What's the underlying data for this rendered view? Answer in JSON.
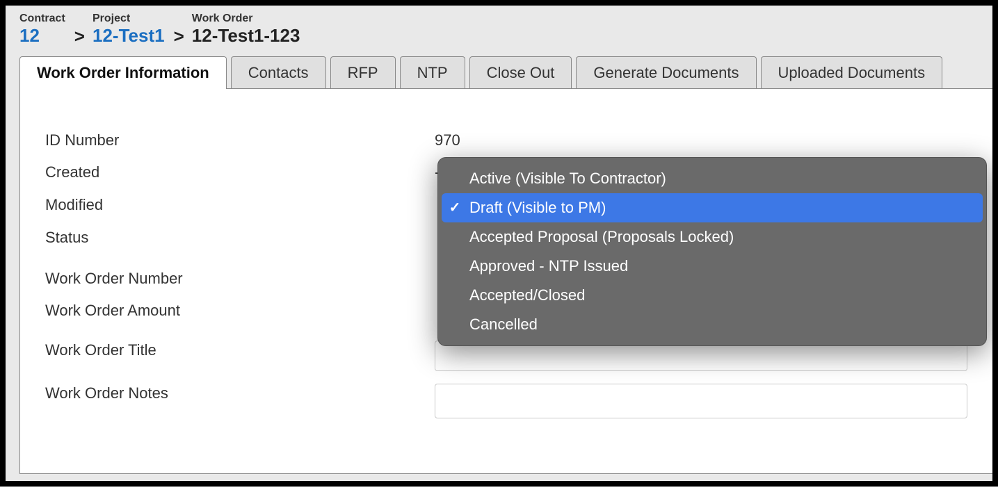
{
  "breadcrumb": {
    "contract": {
      "label": "Contract",
      "value": "12"
    },
    "project": {
      "label": "Project",
      "value": "12-Test1"
    },
    "workorder": {
      "label": "Work Order",
      "value": "12-Test1-123"
    }
  },
  "tabs": [
    {
      "label": "Work Order Information",
      "active": true
    },
    {
      "label": "Contacts"
    },
    {
      "label": "RFP"
    },
    {
      "label": "NTP"
    },
    {
      "label": "Close Out"
    },
    {
      "label": "Generate Documents"
    },
    {
      "label": "Uploaded Documents"
    }
  ],
  "fields": {
    "id_number": {
      "label": "ID Number",
      "value": "970"
    },
    "created": {
      "label": "Created",
      "value": "-"
    },
    "modified": {
      "label": "Modified",
      "value": ""
    },
    "status": {
      "label": "Status",
      "value": "Draft (Visible to PM)"
    },
    "wo_number": {
      "label": "Work Order Number",
      "value": ""
    },
    "wo_amount": {
      "label": "Work Order Amount",
      "value": ""
    },
    "wo_title": {
      "label": "Work Order Title",
      "value": ""
    },
    "wo_notes": {
      "label": "Work Order Notes",
      "value": ""
    }
  },
  "status_options": [
    {
      "label": "Active (Visible To Contractor)",
      "selected": false,
      "checked": false
    },
    {
      "label": "Draft (Visible to PM)",
      "selected": true,
      "checked": true
    },
    {
      "label": "Accepted Proposal (Proposals Locked)",
      "selected": false,
      "checked": false
    },
    {
      "label": "Approved - NTP Issued",
      "selected": false,
      "checked": false
    },
    {
      "label": "Accepted/Closed",
      "selected": false,
      "checked": false
    },
    {
      "label": "Cancelled",
      "selected": false,
      "checked": false
    }
  ]
}
